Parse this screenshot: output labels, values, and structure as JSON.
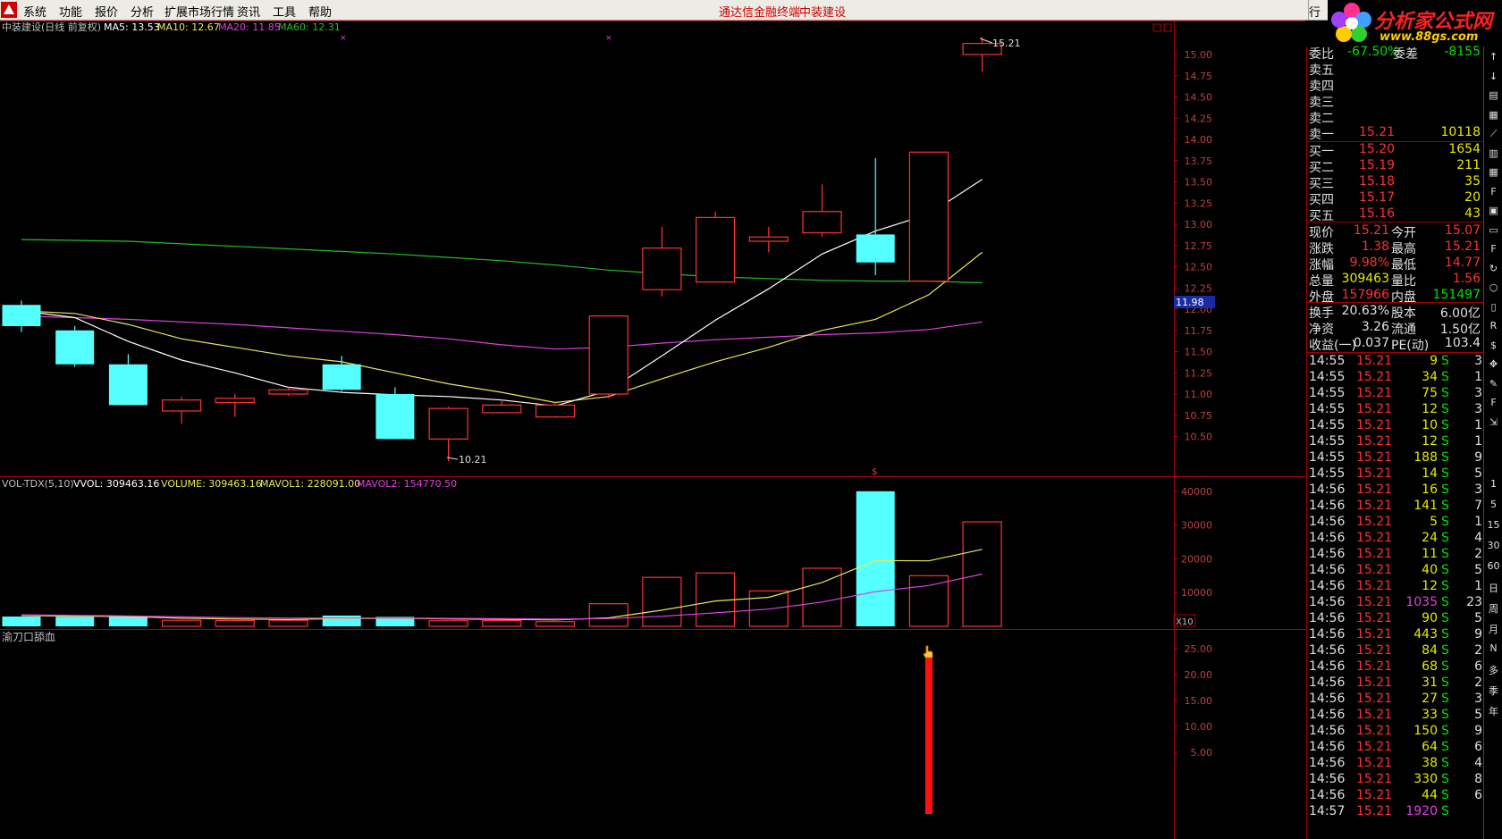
{
  "menu": {
    "items": [
      "系统",
      "功能",
      "报价",
      "分析",
      "扩展市场行情",
      "资讯",
      "工具",
      "帮助"
    ],
    "center_title": "通达信金融终端",
    "center_stock": "中装建设",
    "right_tab": "行"
  },
  "brand": {
    "name": "分析家公式网",
    "url": "www.88gs.com"
  },
  "main_chart": {
    "title": "中装建设(日线 前复权)",
    "ma5": "MA5: 13.53",
    "ma10": "MA10: 12.67",
    "ma20": "MA20: 11.85",
    "ma60": "MA60: 12.31",
    "high_label": "15.21",
    "low_label": "10.21",
    "price_tag": "11.98",
    "y_ticks": [
      "15.00",
      "14.75",
      "14.50",
      "14.25",
      "14.00",
      "13.75",
      "13.50",
      "13.25",
      "13.00",
      "12.75",
      "12.50",
      "12.25",
      "12.00",
      "11.75",
      "11.50",
      "11.25",
      "11.00",
      "10.75",
      "10.50"
    ]
  },
  "volume_chart": {
    "title": "VOL-TDX(5,10)",
    "vvol": "VVOL: 309463.16",
    "volume": "VOLUME: 309463.16",
    "mavol1": "MAVOL1: 228091.00",
    "mavol2": "MAVOL2: 154770.50",
    "unit": "X10",
    "y_ticks": [
      "40000",
      "30000",
      "20000",
      "10000"
    ]
  },
  "indicator_chart": {
    "title": "渝刀口舔血",
    "y_ticks": [
      "25.00",
      "20.00",
      "15.00",
      "10.00",
      "5.00"
    ]
  },
  "chart_data": {
    "type": "candlestick",
    "candles": [
      {
        "o": 12.05,
        "c": 11.8,
        "h": 12.1,
        "l": 11.73
      },
      {
        "o": 11.75,
        "c": 11.35,
        "h": 11.8,
        "l": 11.32
      },
      {
        "o": 11.35,
        "c": 10.87,
        "h": 11.47,
        "l": 10.87
      },
      {
        "o": 10.8,
        "c": 10.93,
        "h": 10.97,
        "l": 10.65
      },
      {
        "o": 10.9,
        "c": 10.95,
        "h": 11.0,
        "l": 10.73
      },
      {
        "o": 11.0,
        "c": 11.05,
        "h": 11.08,
        "l": 10.98
      },
      {
        "o": 11.35,
        "c": 11.05,
        "h": 11.45,
        "l": 11.03
      },
      {
        "o": 11.0,
        "c": 10.47,
        "h": 11.08,
        "l": 10.47
      },
      {
        "o": 10.47,
        "c": 10.83,
        "h": 10.85,
        "l": 10.21
      },
      {
        "o": 10.78,
        "c": 10.87,
        "h": 10.93,
        "l": 10.77
      },
      {
        "o": 10.73,
        "c": 10.87,
        "h": 10.9,
        "l": 10.72
      },
      {
        "o": 11.0,
        "c": 11.92,
        "h": 11.92,
        "l": 10.95
      },
      {
        "o": 12.23,
        "c": 12.72,
        "h": 12.97,
        "l": 12.15
      },
      {
        "o": 12.32,
        "c": 13.08,
        "h": 13.15,
        "l": 12.32
      },
      {
        "o": 12.8,
        "c": 12.85,
        "h": 12.97,
        "l": 12.67
      },
      {
        "o": 12.9,
        "c": 13.15,
        "h": 13.47,
        "l": 12.85
      },
      {
        "o": 12.88,
        "c": 12.55,
        "h": 13.78,
        "l": 12.4
      },
      {
        "o": 12.33,
        "c": 13.85,
        "h": 13.85,
        "l": 12.33
      },
      {
        "o": 15.0,
        "c": 15.13,
        "h": 15.21,
        "l": 14.8
      }
    ],
    "ma5": [
      11.98,
      11.9,
      11.62,
      11.4,
      11.25,
      11.08,
      11.02,
      10.99,
      10.97,
      10.93,
      10.86,
      11.04,
      11.45,
      11.87,
      12.24,
      12.65,
      12.92,
      13.12,
      13.53
    ],
    "ma10": [
      11.98,
      11.95,
      11.82,
      11.65,
      11.55,
      11.45,
      11.38,
      11.25,
      11.12,
      11.02,
      10.9,
      10.97,
      11.18,
      11.38,
      11.55,
      11.75,
      11.88,
      12.17,
      12.67
    ],
    "ma20": [
      11.92,
      11.9,
      11.88,
      11.85,
      11.82,
      11.78,
      11.74,
      11.7,
      11.65,
      11.58,
      11.53,
      11.55,
      11.6,
      11.64,
      11.67,
      11.7,
      11.72,
      11.76,
      11.85
    ],
    "ma60": [
      12.82,
      12.81,
      12.8,
      12.77,
      12.74,
      12.71,
      12.68,
      12.65,
      12.61,
      12.57,
      12.52,
      12.46,
      12.42,
      12.38,
      12.36,
      12.34,
      12.33,
      12.33,
      12.31
    ],
    "volumes": [
      2900,
      2850,
      2900,
      1800,
      1750,
      1800,
      3200,
      2800,
      1650,
      1700,
      1400,
      6700,
      14500,
      15800,
      10500,
      17200,
      40000,
      15000,
      30946
    ],
    "mavol1": [
      3200,
      3000,
      2900,
      2400,
      2200,
      2000,
      2300,
      2400,
      2200,
      2100,
      1900,
      2500,
      4800,
      7500,
      8600,
      13000,
      19500,
      19400,
      22809
    ],
    "mavol2": [
      3400,
      3250,
      3100,
      2800,
      2600,
      2450,
      2450,
      2450,
      2350,
      2300,
      2150,
      2300,
      3000,
      4000,
      5100,
      7200,
      10300,
      12100,
      15477
    ],
    "indicator_value": 24.5,
    "indicator_index": 17
  },
  "quote": {
    "header": {
      "label": "委比",
      "value": "-67.50%",
      "label2": "委差",
      "value2": "-8155"
    },
    "sell": [
      {
        "label": "卖五",
        "price": "",
        "vol": ""
      },
      {
        "label": "卖四",
        "price": "",
        "vol": ""
      },
      {
        "label": "卖三",
        "price": "",
        "vol": ""
      },
      {
        "label": "卖二",
        "price": "",
        "vol": ""
      },
      {
        "label": "卖一",
        "price": "15.21",
        "vol": "10118"
      }
    ],
    "buy": [
      {
        "label": "买一",
        "price": "15.20",
        "vol": "1654"
      },
      {
        "label": "买二",
        "price": "15.19",
        "vol": "211"
      },
      {
        "label": "买三",
        "price": "15.18",
        "vol": "35"
      },
      {
        "label": "买四",
        "price": "15.17",
        "vol": "20"
      },
      {
        "label": "买五",
        "price": "15.16",
        "vol": "43"
      }
    ],
    "stats": [
      {
        "l1": "现价",
        "v1": "15.21",
        "l2": "今开",
        "v2": "15.07",
        "c1": "#ff3030",
        "c2": "#ff3030"
      },
      {
        "l1": "涨跌",
        "v1": "1.38",
        "l2": "最高",
        "v2": "15.21",
        "c1": "#ff3030",
        "c2": "#ff3030"
      },
      {
        "l1": "涨幅",
        "v1": "9.98%",
        "l2": "最低",
        "v2": "14.77",
        "c1": "#ff3030",
        "c2": "#ff3030"
      },
      {
        "l1": "总量",
        "v1": "309463",
        "l2": "量比",
        "v2": "1.56",
        "c1": "#e8e800",
        "c2": "#ff3030"
      },
      {
        "l1": "外盘",
        "v1": "157966",
        "l2": "内盘",
        "v2": "151497",
        "c1": "#ff3030",
        "c2": "#00e000"
      }
    ],
    "stats2": [
      {
        "l1": "换手",
        "v1": "20.63%",
        "l2": "股本",
        "v2": "6.00亿"
      },
      {
        "l1": "净资",
        "v1": "3.26",
        "l2": "流通",
        "v2": "1.50亿"
      },
      {
        "l1": "收益(一)",
        "v1": "0.037",
        "l2": "PE(动)",
        "v2": "103.4"
      }
    ],
    "ticks": [
      {
        "t": "14:55",
        "p": "15.21",
        "v": "9",
        "s": "S",
        "n": "3"
      },
      {
        "t": "14:55",
        "p": "15.21",
        "v": "34",
        "s": "S",
        "n": "1"
      },
      {
        "t": "14:55",
        "p": "15.21",
        "v": "75",
        "s": "S",
        "n": "3"
      },
      {
        "t": "14:55",
        "p": "15.21",
        "v": "12",
        "s": "S",
        "n": "3"
      },
      {
        "t": "14:55",
        "p": "15.21",
        "v": "10",
        "s": "S",
        "n": "1"
      },
      {
        "t": "14:55",
        "p": "15.21",
        "v": "12",
        "s": "S",
        "n": "1"
      },
      {
        "t": "14:55",
        "p": "15.21",
        "v": "188",
        "s": "S",
        "n": "9"
      },
      {
        "t": "14:55",
        "p": "15.21",
        "v": "14",
        "s": "S",
        "n": "5"
      },
      {
        "t": "14:56",
        "p": "15.21",
        "v": "16",
        "s": "S",
        "n": "3"
      },
      {
        "t": "14:56",
        "p": "15.21",
        "v": "141",
        "s": "S",
        "n": "7"
      },
      {
        "t": "14:56",
        "p": "15.21",
        "v": "5",
        "s": "S",
        "n": "1"
      },
      {
        "t": "14:56",
        "p": "15.21",
        "v": "24",
        "s": "S",
        "n": "4"
      },
      {
        "t": "14:56",
        "p": "15.21",
        "v": "11",
        "s": "S",
        "n": "2"
      },
      {
        "t": "14:56",
        "p": "15.21",
        "v": "40",
        "s": "S",
        "n": "5"
      },
      {
        "t": "14:56",
        "p": "15.21",
        "v": "12",
        "s": "S",
        "n": "1"
      },
      {
        "t": "14:56",
        "p": "15.21",
        "v": "1035",
        "s": "S",
        "n": "23",
        "hl": true
      },
      {
        "t": "14:56",
        "p": "15.21",
        "v": "90",
        "s": "S",
        "n": "5"
      },
      {
        "t": "14:56",
        "p": "15.21",
        "v": "443",
        "s": "S",
        "n": "9"
      },
      {
        "t": "14:56",
        "p": "15.21",
        "v": "84",
        "s": "S",
        "n": "2"
      },
      {
        "t": "14:56",
        "p": "15.21",
        "v": "68",
        "s": "S",
        "n": "6"
      },
      {
        "t": "14:56",
        "p": "15.21",
        "v": "31",
        "s": "S",
        "n": "2"
      },
      {
        "t": "14:56",
        "p": "15.21",
        "v": "27",
        "s": "S",
        "n": "3"
      },
      {
        "t": "14:56",
        "p": "15.21",
        "v": "33",
        "s": "S",
        "n": "5"
      },
      {
        "t": "14:56",
        "p": "15.21",
        "v": "150",
        "s": "S",
        "n": "9"
      },
      {
        "t": "14:56",
        "p": "15.21",
        "v": "64",
        "s": "S",
        "n": "6"
      },
      {
        "t": "14:56",
        "p": "15.21",
        "v": "38",
        "s": "S",
        "n": "4"
      },
      {
        "t": "14:56",
        "p": "15.21",
        "v": "330",
        "s": "S",
        "n": "8"
      },
      {
        "t": "14:56",
        "p": "15.21",
        "v": "44",
        "s": "S",
        "n": "6"
      },
      {
        "t": "14:57",
        "p": "15.21",
        "v": "1920",
        "s": "S",
        "n": "",
        "hl": true
      }
    ]
  },
  "toolbar": {
    "icons": [
      "arrow-up-icon",
      "arrow-down-icon",
      "chart-icon",
      "table-icon",
      "line-icon",
      "candle-icon",
      "grid-icon",
      "f10-icon",
      "info-icon",
      "screen-icon",
      "fz-icon",
      "refresh-icon",
      "circle-icon",
      "bar-icon",
      "rsi-icon",
      "dollar-icon",
      "move-icon",
      "draw-icon",
      "fs-icon",
      "export-icon"
    ],
    "icon_labels": [
      "↑",
      "↓",
      "▤",
      "▦",
      "⟋",
      "▥",
      "▦",
      "F",
      "▣",
      "▭",
      "F",
      "↻",
      "○",
      "▯",
      "R",
      "$",
      "✥",
      "✎",
      "F",
      "⇲"
    ],
    "periods": [
      "1",
      "5",
      "15",
      "30",
      "60",
      "日",
      "周",
      "月",
      "N",
      "多",
      "季",
      "年"
    ]
  },
  "colors": {
    "up": "#ff3232",
    "down": "#54ffff",
    "ma5": "#ffffff",
    "ma10": "#e8e85a",
    "ma20": "#e040e0",
    "ma60": "#20c020",
    "axis_red": "#b00000"
  }
}
